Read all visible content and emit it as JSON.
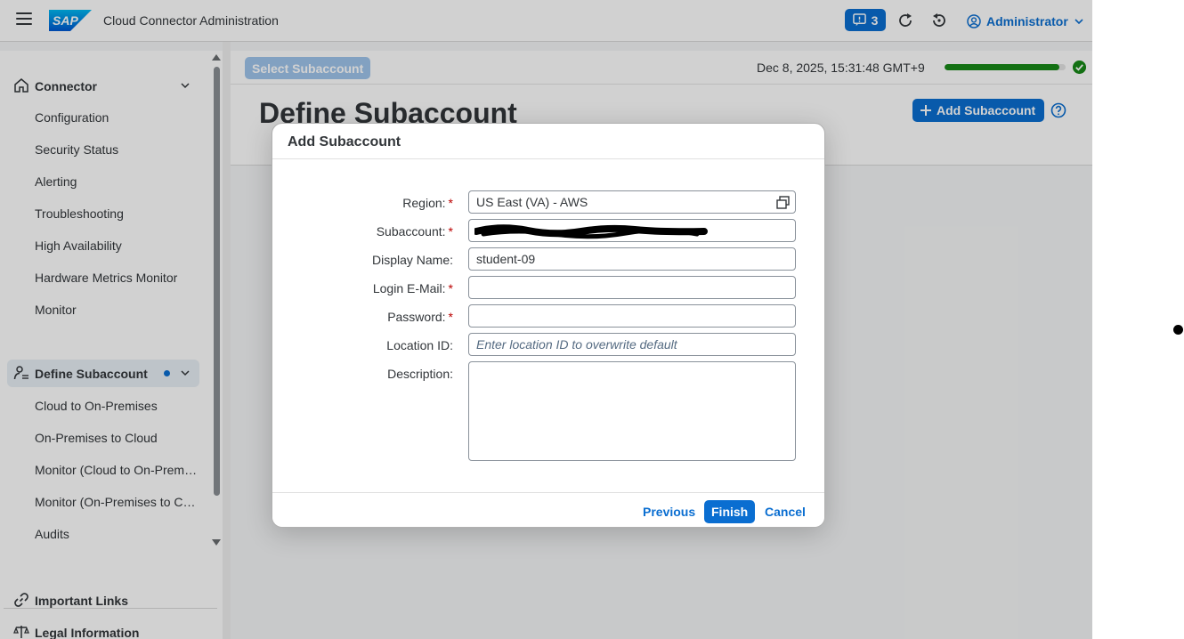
{
  "header": {
    "app_title": "Cloud Connector Administration",
    "logo_text": "SAP",
    "notifications_count": "3",
    "user_name": "Administrator"
  },
  "sidebar": {
    "connector_group": "Connector",
    "connector_items": [
      "Configuration",
      "Security Status",
      "Alerting",
      "Troubleshooting",
      "High Availability",
      "Hardware Metrics Monitor",
      "Monitor"
    ],
    "subaccount_group": "Define Subaccount",
    "subaccount_items": [
      "Cloud to On-Premises",
      "On-Premises to Cloud",
      "Monitor (Cloud to On-Premises)",
      "Monitor (On-Premises to Cloud)",
      "Audits"
    ],
    "important_links": "Important Links",
    "legal_information": "Legal Information"
  },
  "toolbar": {
    "select_subaccount": "Select Subaccount",
    "datetime": "Dec 8, 2025, 15:31:48 GMT+9",
    "progress": 0.95
  },
  "page": {
    "title": "Define Subaccount",
    "add_button": "Add Subaccount"
  },
  "dialog": {
    "title": "Add Subaccount",
    "fields": {
      "region_label": "Region:",
      "region_value": "US East (VA) - AWS",
      "subaccount_label": "Subaccount:",
      "display_name_label": "Display Name:",
      "display_name_value": "student-09",
      "email_label": "Login E-Mail:",
      "email_value": "",
      "password_label": "Password:",
      "password_value": "",
      "location_label": "Location ID:",
      "location_placeholder": "Enter location ID to overwrite default",
      "description_label": "Description:"
    },
    "required_mark": "*",
    "buttons": {
      "previous": "Previous",
      "finish": "Finish",
      "cancel": "Cancel"
    }
  },
  "colors": {
    "accent": "#0a6ed1",
    "success": "#188918",
    "required": "#bb0000"
  }
}
